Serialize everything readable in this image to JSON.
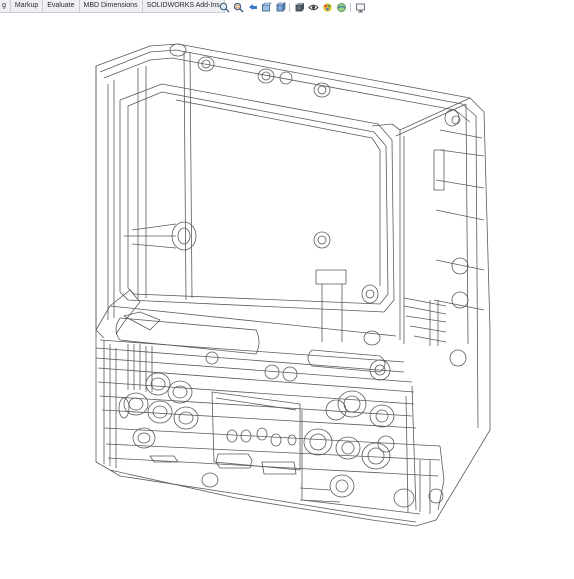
{
  "command_manager": {
    "tabs": [
      {
        "name": "tab-partial",
        "label": "g"
      },
      {
        "name": "tab-markup",
        "label": "Markup"
      },
      {
        "name": "tab-evaluate",
        "label": "Evaluate"
      },
      {
        "name": "tab-mbd-dimensions",
        "label": "MBD Dimensions"
      },
      {
        "name": "tab-solidworks-addins",
        "label": "SOLIDWORKS Add-Ins"
      }
    ]
  },
  "headsup_toolbar": {
    "icons": [
      "zoom-to-fit-icon",
      "zoom-to-area-icon",
      "previous-view-icon",
      "section-view-icon",
      "view-orientation-icon",
      "display-style-icon",
      "hide-show-items-icon",
      "edit-appearance-icon",
      "apply-scene-icon",
      "view-settings-icon"
    ]
  },
  "viewport": {
    "model_name": "wireframe-enclosure",
    "display_style": "hidden lines visible",
    "colors": {
      "edges": "#5b5b5b",
      "background": "#ffffff",
      "toolbar": "#eef0f3"
    }
  }
}
